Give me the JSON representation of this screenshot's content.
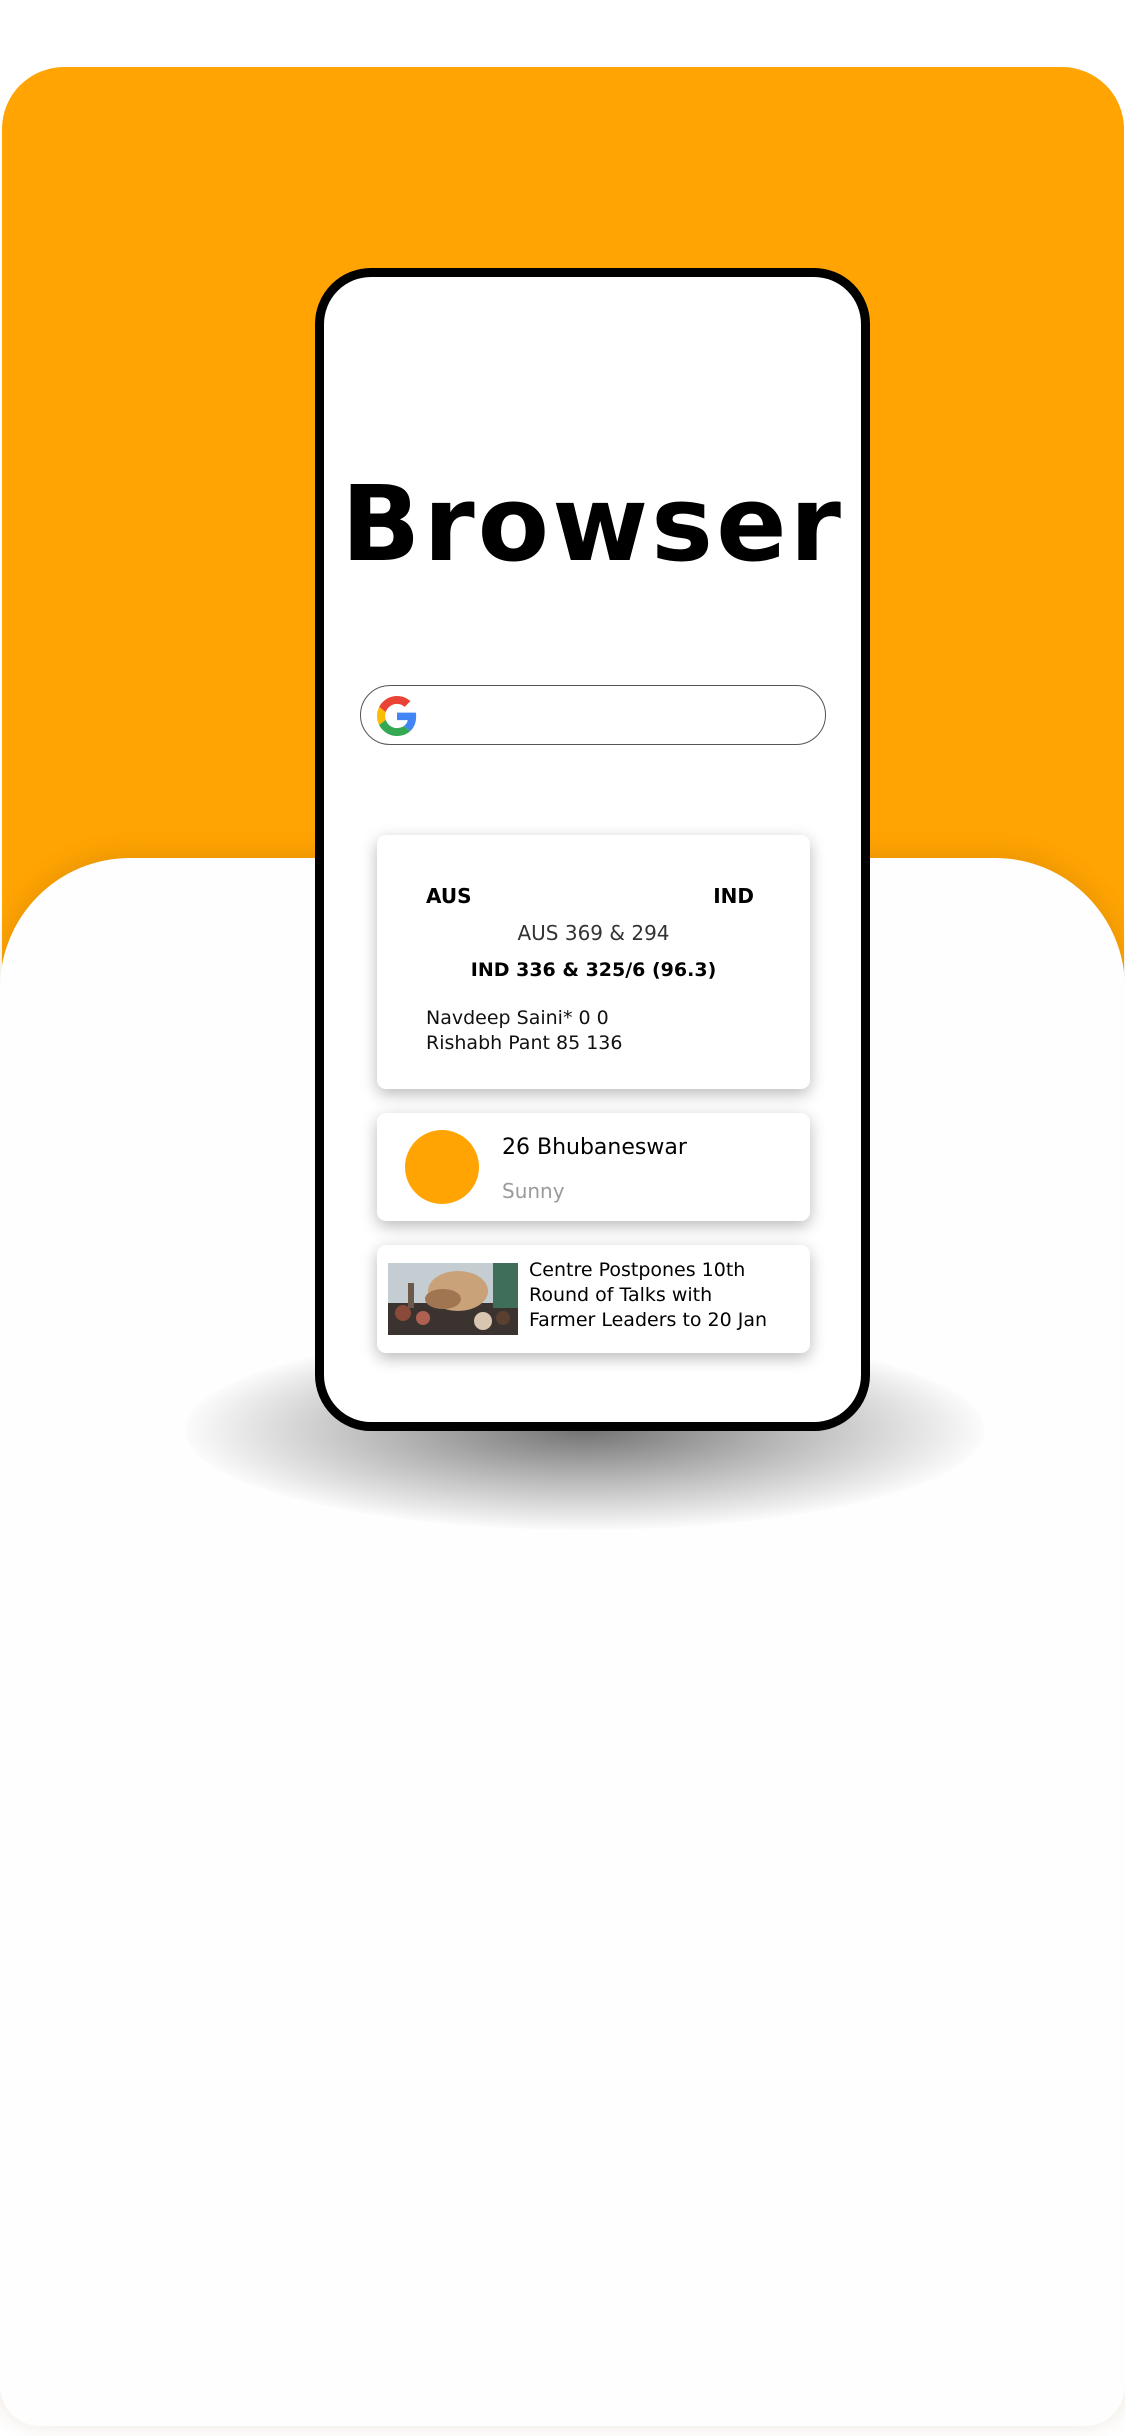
{
  "app": {
    "title": "Browser"
  },
  "colors": {
    "accent": "#FFA403",
    "frame": "#000000",
    "muted_text": "#9a9a9a"
  },
  "search": {
    "icon": "google-g-icon"
  },
  "score_card": {
    "team_left": "AUS",
    "team_right": "IND",
    "aus_score": "AUS 369 & 294",
    "ind_score": "IND 336 & 325/6 (96.3)",
    "batters": [
      "Navdeep Saini* 0 0",
      "Rishabh Pant 85 136"
    ]
  },
  "weather_card": {
    "icon": "sun-icon",
    "city_line": "26 Bhubaneswar",
    "condition": "Sunny"
  },
  "news_card": {
    "image": "news-thumbnail",
    "headline_lines": [
      "Centre Postpones 10th",
      "Round of Talks with",
      "Farmer Leaders to 20 Jan"
    ]
  }
}
